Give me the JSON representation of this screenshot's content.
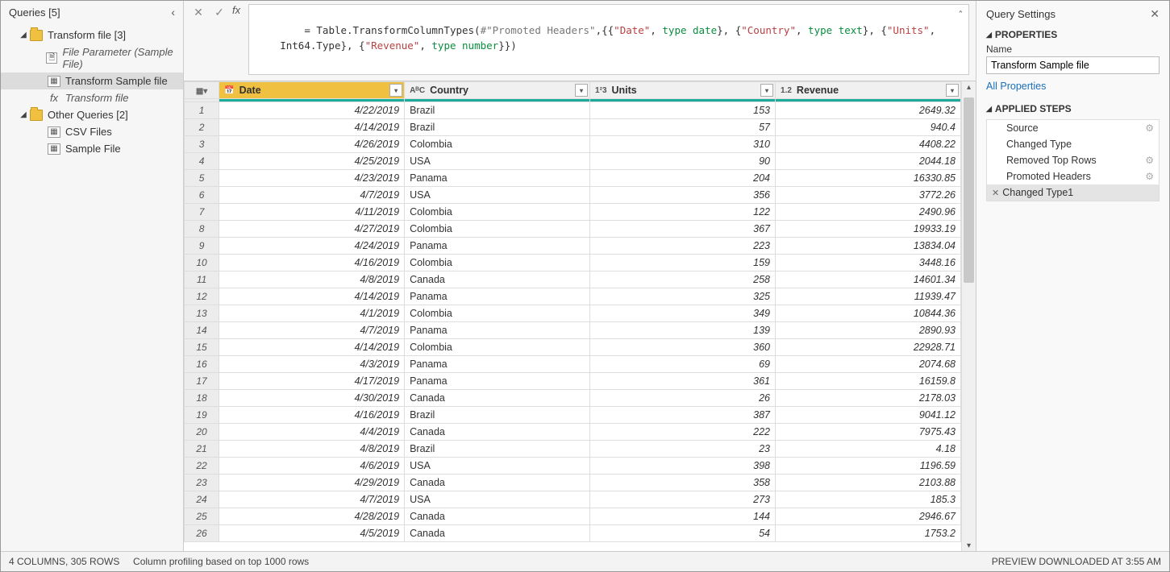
{
  "queries": {
    "title": "Queries [5]",
    "groups": [
      {
        "label": "Transform file [3]",
        "items": [
          {
            "label": "File Parameter (Sample File)",
            "kind": "param",
            "italic": true
          },
          {
            "label": "Transform Sample file",
            "kind": "table",
            "selected": true
          },
          {
            "label": "Transform file",
            "kind": "fx",
            "italic": true
          }
        ]
      },
      {
        "label": "Other Queries [2]",
        "items": [
          {
            "label": "CSV Files",
            "kind": "table"
          },
          {
            "label": "Sample File",
            "kind": "table"
          }
        ]
      }
    ]
  },
  "formula": {
    "prefix": "= ",
    "text_plain": "Table.TransformColumnTypes(#\"Promoted Headers\",{{\"Date\", type date}, {\"Country\", type text}, {\"Units\", Int64.Type}, {\"Revenue\", type number}})"
  },
  "columns": [
    {
      "name": "Date",
      "type_icon": "📅",
      "selected": true
    },
    {
      "name": "Country",
      "type_icon": "AᴮC"
    },
    {
      "name": "Units",
      "type_icon": "1²3"
    },
    {
      "name": "Revenue",
      "type_icon": "1.2"
    }
  ],
  "rows": [
    {
      "n": 1,
      "date": "4/22/2019",
      "country": "Brazil",
      "units": "153",
      "revenue": "2649.32"
    },
    {
      "n": 2,
      "date": "4/14/2019",
      "country": "Brazil",
      "units": "57",
      "revenue": "940.4"
    },
    {
      "n": 3,
      "date": "4/26/2019",
      "country": "Colombia",
      "units": "310",
      "revenue": "4408.22"
    },
    {
      "n": 4,
      "date": "4/25/2019",
      "country": "USA",
      "units": "90",
      "revenue": "2044.18"
    },
    {
      "n": 5,
      "date": "4/23/2019",
      "country": "Panama",
      "units": "204",
      "revenue": "16330.85"
    },
    {
      "n": 6,
      "date": "4/7/2019",
      "country": "USA",
      "units": "356",
      "revenue": "3772.26"
    },
    {
      "n": 7,
      "date": "4/11/2019",
      "country": "Colombia",
      "units": "122",
      "revenue": "2490.96"
    },
    {
      "n": 8,
      "date": "4/27/2019",
      "country": "Colombia",
      "units": "367",
      "revenue": "19933.19"
    },
    {
      "n": 9,
      "date": "4/24/2019",
      "country": "Panama",
      "units": "223",
      "revenue": "13834.04"
    },
    {
      "n": 10,
      "date": "4/16/2019",
      "country": "Colombia",
      "units": "159",
      "revenue": "3448.16"
    },
    {
      "n": 11,
      "date": "4/8/2019",
      "country": "Canada",
      "units": "258",
      "revenue": "14601.34"
    },
    {
      "n": 12,
      "date": "4/14/2019",
      "country": "Panama",
      "units": "325",
      "revenue": "11939.47"
    },
    {
      "n": 13,
      "date": "4/1/2019",
      "country": "Colombia",
      "units": "349",
      "revenue": "10844.36"
    },
    {
      "n": 14,
      "date": "4/7/2019",
      "country": "Panama",
      "units": "139",
      "revenue": "2890.93"
    },
    {
      "n": 15,
      "date": "4/14/2019",
      "country": "Colombia",
      "units": "360",
      "revenue": "22928.71"
    },
    {
      "n": 16,
      "date": "4/3/2019",
      "country": "Panama",
      "units": "69",
      "revenue": "2074.68"
    },
    {
      "n": 17,
      "date": "4/17/2019",
      "country": "Panama",
      "units": "361",
      "revenue": "16159.8"
    },
    {
      "n": 18,
      "date": "4/30/2019",
      "country": "Canada",
      "units": "26",
      "revenue": "2178.03"
    },
    {
      "n": 19,
      "date": "4/16/2019",
      "country": "Brazil",
      "units": "387",
      "revenue": "9041.12"
    },
    {
      "n": 20,
      "date": "4/4/2019",
      "country": "Canada",
      "units": "222",
      "revenue": "7975.43"
    },
    {
      "n": 21,
      "date": "4/8/2019",
      "country": "Brazil",
      "units": "23",
      "revenue": "4.18"
    },
    {
      "n": 22,
      "date": "4/6/2019",
      "country": "USA",
      "units": "398",
      "revenue": "1196.59"
    },
    {
      "n": 23,
      "date": "4/29/2019",
      "country": "Canada",
      "units": "358",
      "revenue": "2103.88"
    },
    {
      "n": 24,
      "date": "4/7/2019",
      "country": "USA",
      "units": "273",
      "revenue": "185.3"
    },
    {
      "n": 25,
      "date": "4/28/2019",
      "country": "Canada",
      "units": "144",
      "revenue": "2946.67"
    },
    {
      "n": 26,
      "date": "4/5/2019",
      "country": "Canada",
      "units": "54",
      "revenue": "1753.2"
    }
  ],
  "settings": {
    "title": "Query Settings",
    "properties_label": "PROPERTIES",
    "name_label": "Name",
    "name_value": "Transform Sample file",
    "all_properties": "All Properties",
    "applied_steps_label": "APPLIED STEPS",
    "steps": [
      {
        "label": "Source",
        "gear": true
      },
      {
        "label": "Changed Type"
      },
      {
        "label": "Removed Top Rows",
        "gear": true
      },
      {
        "label": "Promoted Headers",
        "gear": true
      },
      {
        "label": "Changed Type1",
        "selected": true
      }
    ]
  },
  "statusbar": {
    "left1": "4 COLUMNS, 305 ROWS",
    "left2": "Column profiling based on top 1000 rows",
    "right": "PREVIEW DOWNLOADED AT 3:55 AM"
  }
}
